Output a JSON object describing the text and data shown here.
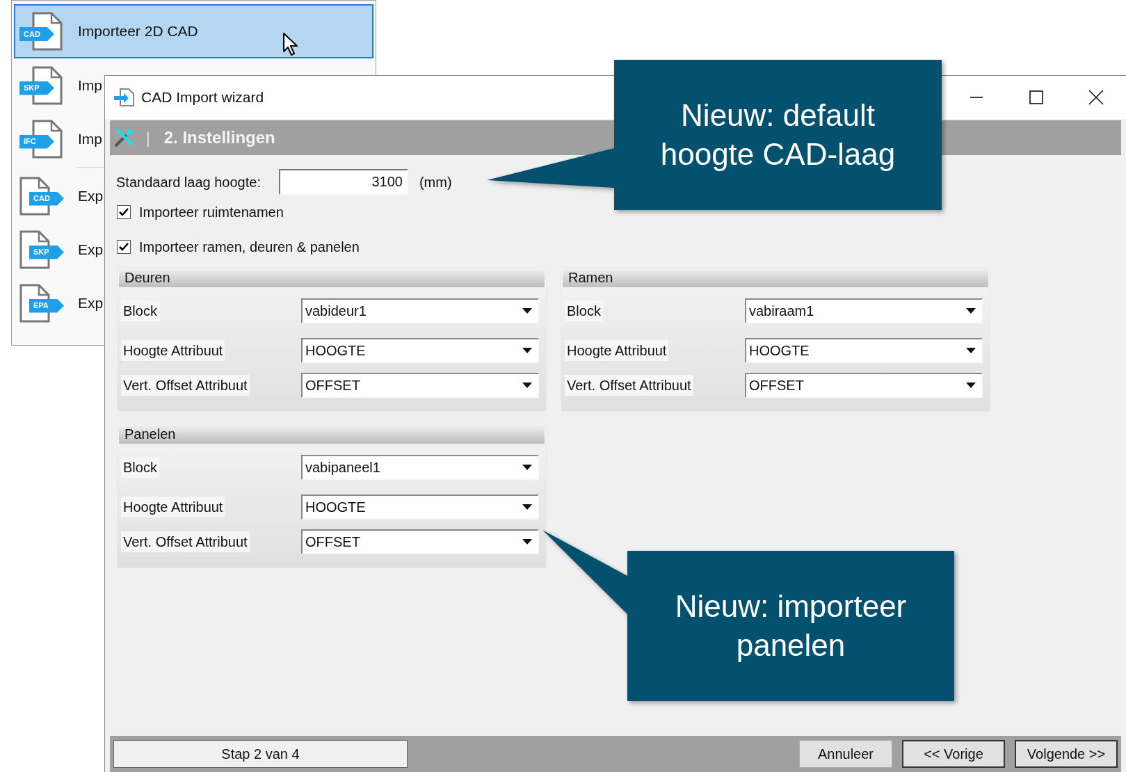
{
  "menu": {
    "items": [
      {
        "label": "Importeer 2D CAD",
        "icon_label": "CAD",
        "kind": "import",
        "selected": true
      },
      {
        "label": "Imp",
        "icon_label": "SKP",
        "kind": "import",
        "selected": false
      },
      {
        "label": "Imp",
        "icon_label": "IFC",
        "kind": "import",
        "selected": false
      },
      {
        "label": "Exp",
        "icon_label": "CAD",
        "kind": "export",
        "selected": false
      },
      {
        "label": "Exp",
        "icon_label": "SKP",
        "kind": "export",
        "selected": false
      },
      {
        "label": "Exp",
        "icon_label": "EPA",
        "kind": "export",
        "selected": false
      }
    ]
  },
  "window": {
    "title": "CAD Import wizard"
  },
  "header": {
    "separator": "|",
    "title": "2. Instellingen"
  },
  "height_field": {
    "label": "Standaard laag hoogte:",
    "value": "3100",
    "unit": "(mm)"
  },
  "checkboxes": [
    {
      "label": "Importeer ruimtenamen",
      "checked": true
    },
    {
      "label": "Importeer ramen, deuren & panelen",
      "checked": true
    }
  ],
  "groups": [
    {
      "title": "Deuren",
      "fields": [
        {
          "label": "Block",
          "value": "vabideur1"
        },
        {
          "label": "Hoogte Attribuut",
          "value": "HOOGTE"
        },
        {
          "label": "Vert. Offset Attribuut",
          "value": "OFFSET"
        }
      ]
    },
    {
      "title": "Ramen",
      "fields": [
        {
          "label": "Block",
          "value": "vabiraam1"
        },
        {
          "label": "Hoogte Attribuut",
          "value": "HOOGTE"
        },
        {
          "label": "Vert. Offset Attribuut",
          "value": "OFFSET"
        }
      ]
    },
    {
      "title": "Panelen",
      "fields": [
        {
          "label": "Block",
          "value": "vabipaneel1"
        },
        {
          "label": "Hoogte Attribuut",
          "value": "HOOGTE"
        },
        {
          "label": "Vert. Offset Attribuut",
          "value": "OFFSET"
        }
      ]
    }
  ],
  "footer": {
    "step": "Stap 2 van 4",
    "buttons": [
      "Annuleer",
      "<< Vorige",
      "Volgende >>"
    ]
  },
  "callouts": [
    {
      "text": "Nieuw: default hoogte CAD-laag"
    },
    {
      "text": "Nieuw: importeer panelen"
    }
  ]
}
